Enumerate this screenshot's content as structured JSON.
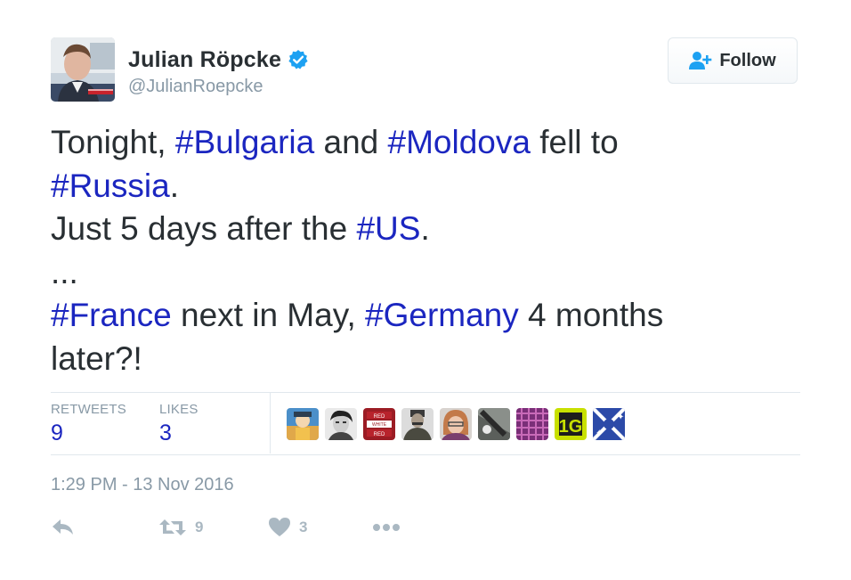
{
  "author": {
    "display_name": "Julian Röpcke",
    "handle": "@JulianRoepcke",
    "verified": true
  },
  "follow_button": {
    "label": "Follow"
  },
  "tweet": {
    "lines": [
      [
        {
          "t": "Tonight, ",
          "h": false
        },
        {
          "t": "#Bulgaria",
          "h": true
        },
        {
          "t": " and ",
          "h": false
        },
        {
          "t": "#Moldova",
          "h": true
        },
        {
          "t": " fell to",
          "h": false
        }
      ],
      [
        {
          "t": "#Russia",
          "h": true
        },
        {
          "t": ".",
          "h": false
        }
      ],
      [
        {
          "t": "Just 5 days after the ",
          "h": false
        },
        {
          "t": "#US",
          "h": true
        },
        {
          "t": ".",
          "h": false
        }
      ],
      [
        {
          "t": "...",
          "h": false
        }
      ],
      [
        {
          "t": "#France",
          "h": true
        },
        {
          "t": " next in May, ",
          "h": false
        },
        {
          "t": "#Germany",
          "h": true
        },
        {
          "t": " 4 months",
          "h": false
        }
      ],
      [
        {
          "t": "later?!",
          "h": false
        }
      ]
    ]
  },
  "stats": {
    "retweets_label": "RETWEETS",
    "retweets_count": "9",
    "likes_label": "LIKES",
    "likes_count": "3"
  },
  "likers_avatars_count": 9,
  "timestamp": "1:29 PM - 13 Nov 2016",
  "actions": {
    "reply_icon": "reply-icon",
    "retweet_icon": "retweet-icon",
    "retweet_count": "9",
    "like_icon": "heart-icon",
    "like_count": "3",
    "more_icon": "more-icon"
  },
  "colors": {
    "hashtag": "#1b26c0",
    "verified": "#1da1f2",
    "muted": "#8899a6",
    "action": "#aab8c2"
  }
}
